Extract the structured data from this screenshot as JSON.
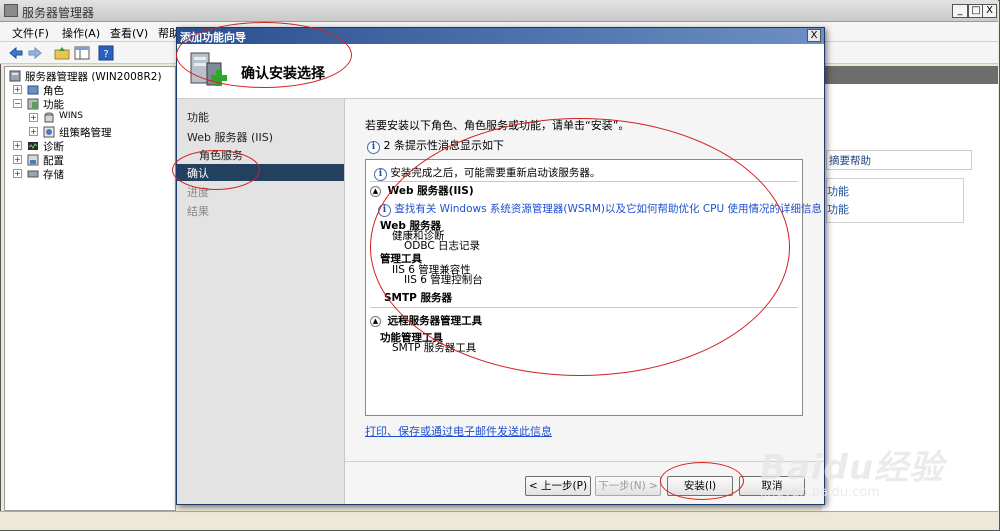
{
  "main_window": {
    "title": "服务器管理器",
    "controls": {
      "minimize": "_",
      "maximize": "□",
      "close": "X"
    },
    "menu": [
      "文件(F)",
      "操作(A)",
      "查看(V)",
      "帮助"
    ],
    "tree": [
      {
        "label": "服务器管理器 (WIN2008R2)",
        "level": 0,
        "expander": ""
      },
      {
        "label": "角色",
        "level": 1,
        "expander": "+"
      },
      {
        "label": "功能",
        "level": 1,
        "expander": "−"
      },
      {
        "label": "WINS",
        "level": 2,
        "expander": "+"
      },
      {
        "label": "组策略管理",
        "level": 2,
        "expander": "+"
      },
      {
        "label": "诊断",
        "level": 1,
        "expander": "+"
      },
      {
        "label": "配置",
        "level": 1,
        "expander": "+"
      },
      {
        "label": "存储",
        "level": 1,
        "expander": "+"
      }
    ],
    "right_pane": {
      "help_link": "摘要帮助",
      "links": [
        "功能",
        "功能"
      ]
    }
  },
  "wizard": {
    "title": "添加功能向导",
    "close": "X",
    "heading": "确认安装选择",
    "nav": [
      {
        "label": "功能",
        "state": "done"
      },
      {
        "label": "Web 服务器 (IIS)",
        "state": "done"
      },
      {
        "label": "角色服务",
        "state": "done",
        "indent": true
      },
      {
        "label": "确认",
        "state": "current"
      },
      {
        "label": "进度",
        "state": "pending"
      },
      {
        "label": "结果",
        "state": "pending"
      }
    ],
    "instruction": "若要安装以下角色、角色服务或功能，请单击“安装”。",
    "message_count": "2 条提示性消息显示如下",
    "summary": {
      "restart_note": "安装完成之后，可能需要重新启动该服务器。",
      "section1_title": "Web 服务器(IIS)",
      "section1_link": "查找有关 Windows 系统资源管理器(WSRM)以及它如何帮助优化 CPU 使用情况的详细信息",
      "section1_lines": [
        {
          "text": "Web 服务器",
          "bold": true,
          "indent": 0
        },
        {
          "text": "健康和诊断",
          "bold": false,
          "indent": 1
        },
        {
          "text": "ODBC 日志记录",
          "bold": false,
          "indent": 2
        },
        {
          "text": "管理工具",
          "bold": true,
          "indent": 0
        },
        {
          "text": "IIS 6 管理兼容性",
          "bold": false,
          "indent": 1
        },
        {
          "text": "IIS 6 管理控制台",
          "bold": false,
          "indent": 2
        },
        {
          "text": "SMTP 服务器",
          "bold": true,
          "indent": 0
        }
      ],
      "section2_title": "远程服务器管理工具",
      "section2_lines": [
        {
          "text": "功能管理工具",
          "bold": true,
          "indent": 0
        },
        {
          "text": "SMTP 服务器工具",
          "bold": false,
          "indent": 1
        }
      ]
    },
    "print_link": "打印、保存或通过电子邮件发送此信息",
    "buttons": {
      "back": "< 上一步(P)",
      "next": "下一步(N) >",
      "install": "安装(I)",
      "cancel": "取消"
    }
  },
  "watermark": {
    "logo": "Baidu经验",
    "url": "jingyan.baidu.com"
  },
  "colors": {
    "annotation": "#d51f1f",
    "wizard_titlebar": "#2a4f8f",
    "nav_selected": "#23415f",
    "link": "#1f4fd0"
  }
}
